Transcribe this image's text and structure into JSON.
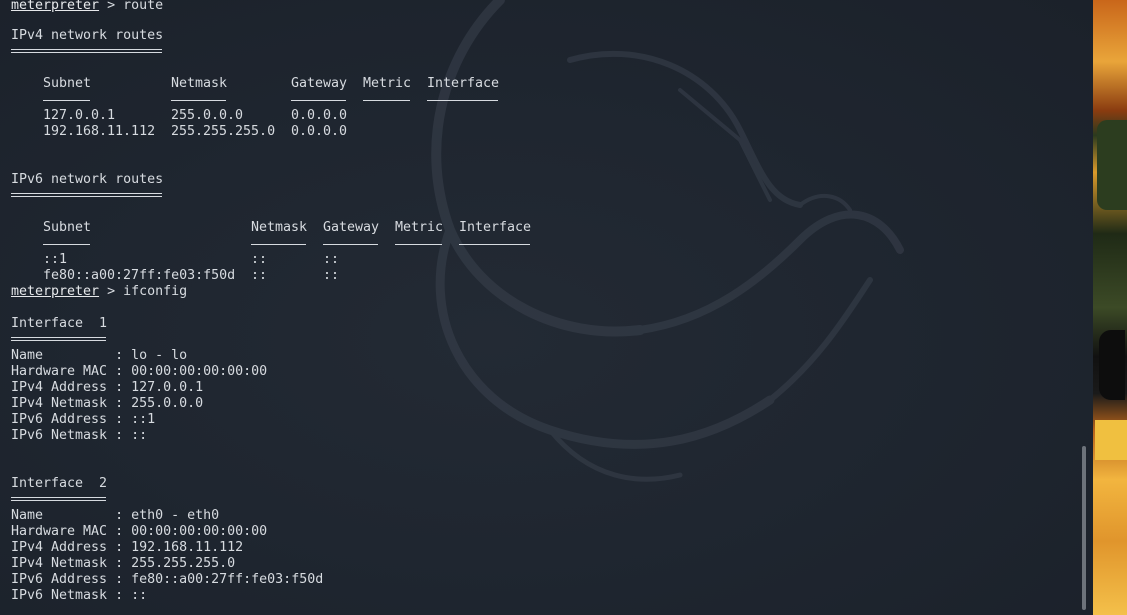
{
  "prompt": "meterpreter",
  "cmd_route": " > route",
  "cmd_ifconfig": " > ifconfig",
  "ipv4_title": "IPv4 network routes",
  "ipv6_title": "IPv6 network routes",
  "route_headers": {
    "subnet": "Subnet",
    "netmask": "Netmask",
    "gateway": "Gateway",
    "metric": "Metric",
    "interface": "Interface"
  },
  "ipv4_routes": [
    {
      "subnet": "127.0.0.1",
      "netmask": "255.0.0.0",
      "gateway": "0.0.0.0"
    },
    {
      "subnet": "192.168.11.112",
      "netmask": "255.255.255.0",
      "gateway": "0.0.0.0"
    }
  ],
  "ipv6_routes": [
    {
      "subnet": "::1",
      "netmask": "::",
      "gateway": "::"
    },
    {
      "subnet": "fe80::a00:27ff:fe03:f50d",
      "netmask": "::",
      "gateway": "::"
    }
  ],
  "interfaces": [
    {
      "title": "Interface  1",
      "lines": [
        "Name         : lo - lo",
        "Hardware MAC : 00:00:00:00:00:00",
        "IPv4 Address : 127.0.0.1",
        "IPv4 Netmask : 255.0.0.0",
        "IPv6 Address : ::1",
        "IPv6 Netmask : ::"
      ]
    },
    {
      "title": "Interface  2",
      "lines": [
        "Name         : eth0 - eth0",
        "Hardware MAC : 00:00:00:00:00:00",
        "IPv4 Address : 192.168.11.112",
        "IPv4 Netmask : 255.255.255.0",
        "IPv6 Address : fe80::a00:27ff:fe03:f50d",
        "IPv6 Netmask : ::"
      ]
    }
  ],
  "colors": {
    "background": "#1c222c",
    "text": "#d7dbe0",
    "scrollbar": "#6d737b"
  }
}
